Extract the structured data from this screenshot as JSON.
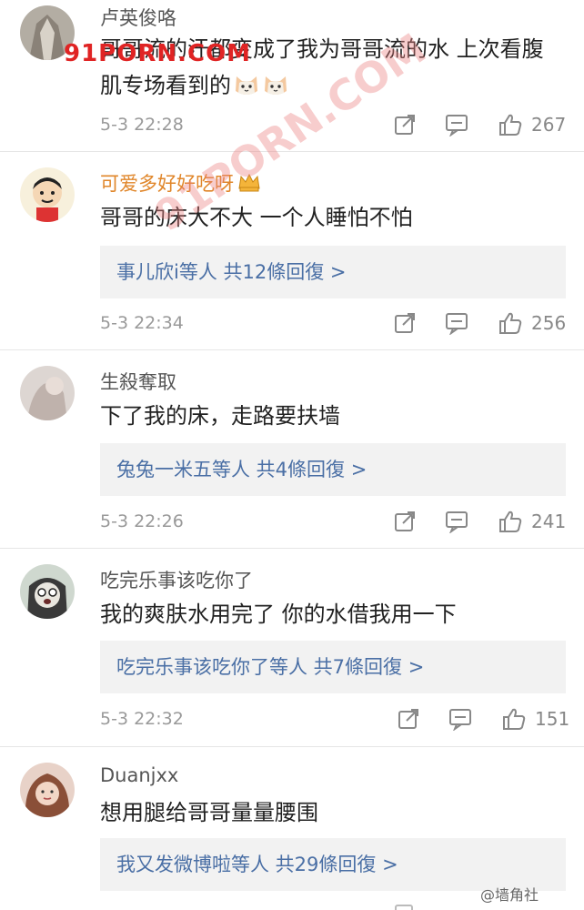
{
  "comments": [
    {
      "user": "卢英俊咯",
      "text": "哥哥流的汗都变成了我为哥哥流的水  上次看腹肌专场看到的",
      "time": "5-3 22:28",
      "likes": "267"
    },
    {
      "user": "可爱多好好吃呀",
      "text": "哥哥的床大不大 一个人睡怕不怕",
      "replies": "事儿欣i等人 共12條回復 >",
      "time": "5-3 22:34",
      "likes": "256"
    },
    {
      "user": "生殺奪取",
      "text": "下了我的床，走路要扶墙",
      "replies": "兔兔一米五等人 共4條回復 >",
      "time": "5-3 22:26",
      "likes": "241"
    },
    {
      "user": "吃完乐事该吃你了",
      "text": "我的爽肤水用完了 你的水借我用一下",
      "replies": "吃完乐事该吃你了等人 共7條回復 >",
      "time": "5-3 22:32",
      "likes": "151"
    },
    {
      "user": "Duanjxx",
      "text": "想用腿给哥哥量量腰围",
      "replies": "我又发微博啦等人 共29條回復 >",
      "time": "",
      "likes": ""
    }
  ],
  "watermarks": {
    "top": "91PORN.COM",
    "diagonal": "91PORN.COM",
    "bottom": "@墙角社"
  },
  "icons": {
    "repost": "repost-icon",
    "comment": "comment-icon",
    "like": "thumbs-up-icon"
  },
  "colors": {
    "username": "#555555",
    "username_vip": "#e0862a",
    "reply_link": "#4a6fa5",
    "reply_bg": "#f2f2f2",
    "meta": "#999999",
    "watermark": "#e02424"
  }
}
